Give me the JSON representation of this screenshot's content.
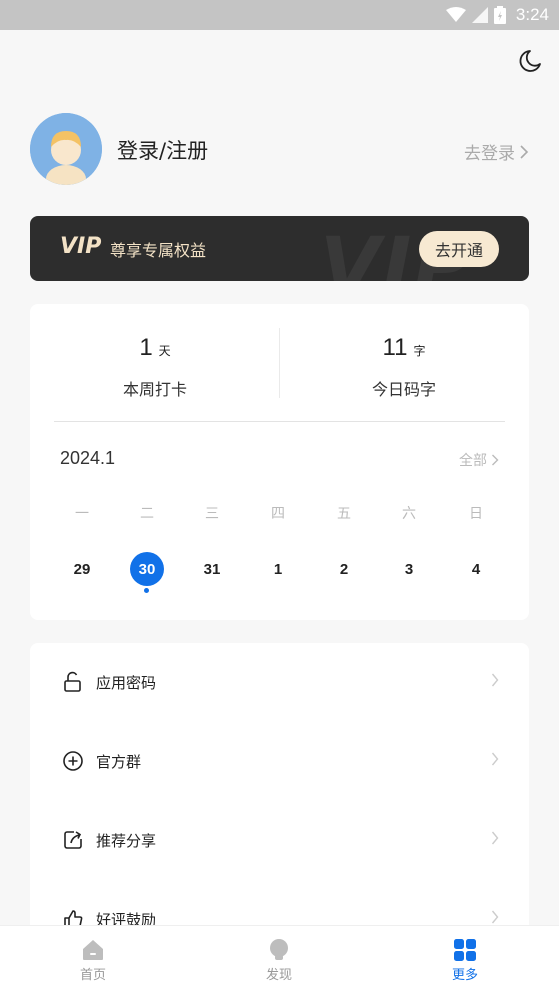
{
  "status_bar": {
    "time": "3:24"
  },
  "profile": {
    "title": "登录/注册",
    "action": "去登录"
  },
  "vip": {
    "logo": "VIP",
    "watermark": "VIP",
    "text": "尊享专属权益",
    "button": "去开通"
  },
  "stats": [
    {
      "value": "1",
      "unit": "天",
      "label": "本周打卡"
    },
    {
      "value": "11",
      "unit": "字",
      "label": "今日码字"
    }
  ],
  "calendar": {
    "month": "2024.1",
    "all_label": "全部",
    "weekdays": [
      "一",
      "二",
      "三",
      "四",
      "五",
      "六",
      "日"
    ],
    "dates": [
      "29",
      "30",
      "31",
      "1",
      "2",
      "3",
      "4"
    ]
  },
  "menu": [
    {
      "label": "应用密码",
      "icon": "lock-icon"
    },
    {
      "label": "官方群",
      "icon": "plus-circle-icon"
    },
    {
      "label": "推荐分享",
      "icon": "share-icon"
    },
    {
      "label": "好评鼓励",
      "icon": "thumbs-up-icon"
    }
  ],
  "tabs": [
    {
      "label": "首页",
      "icon": "home-icon"
    },
    {
      "label": "发现",
      "icon": "bulb-icon"
    },
    {
      "label": "更多",
      "icon": "grid-icon"
    }
  ],
  "colors": {
    "accent": "#1171e8",
    "vip_bg": "#2d2d2d",
    "vip_gold": "#f3e2c6"
  }
}
